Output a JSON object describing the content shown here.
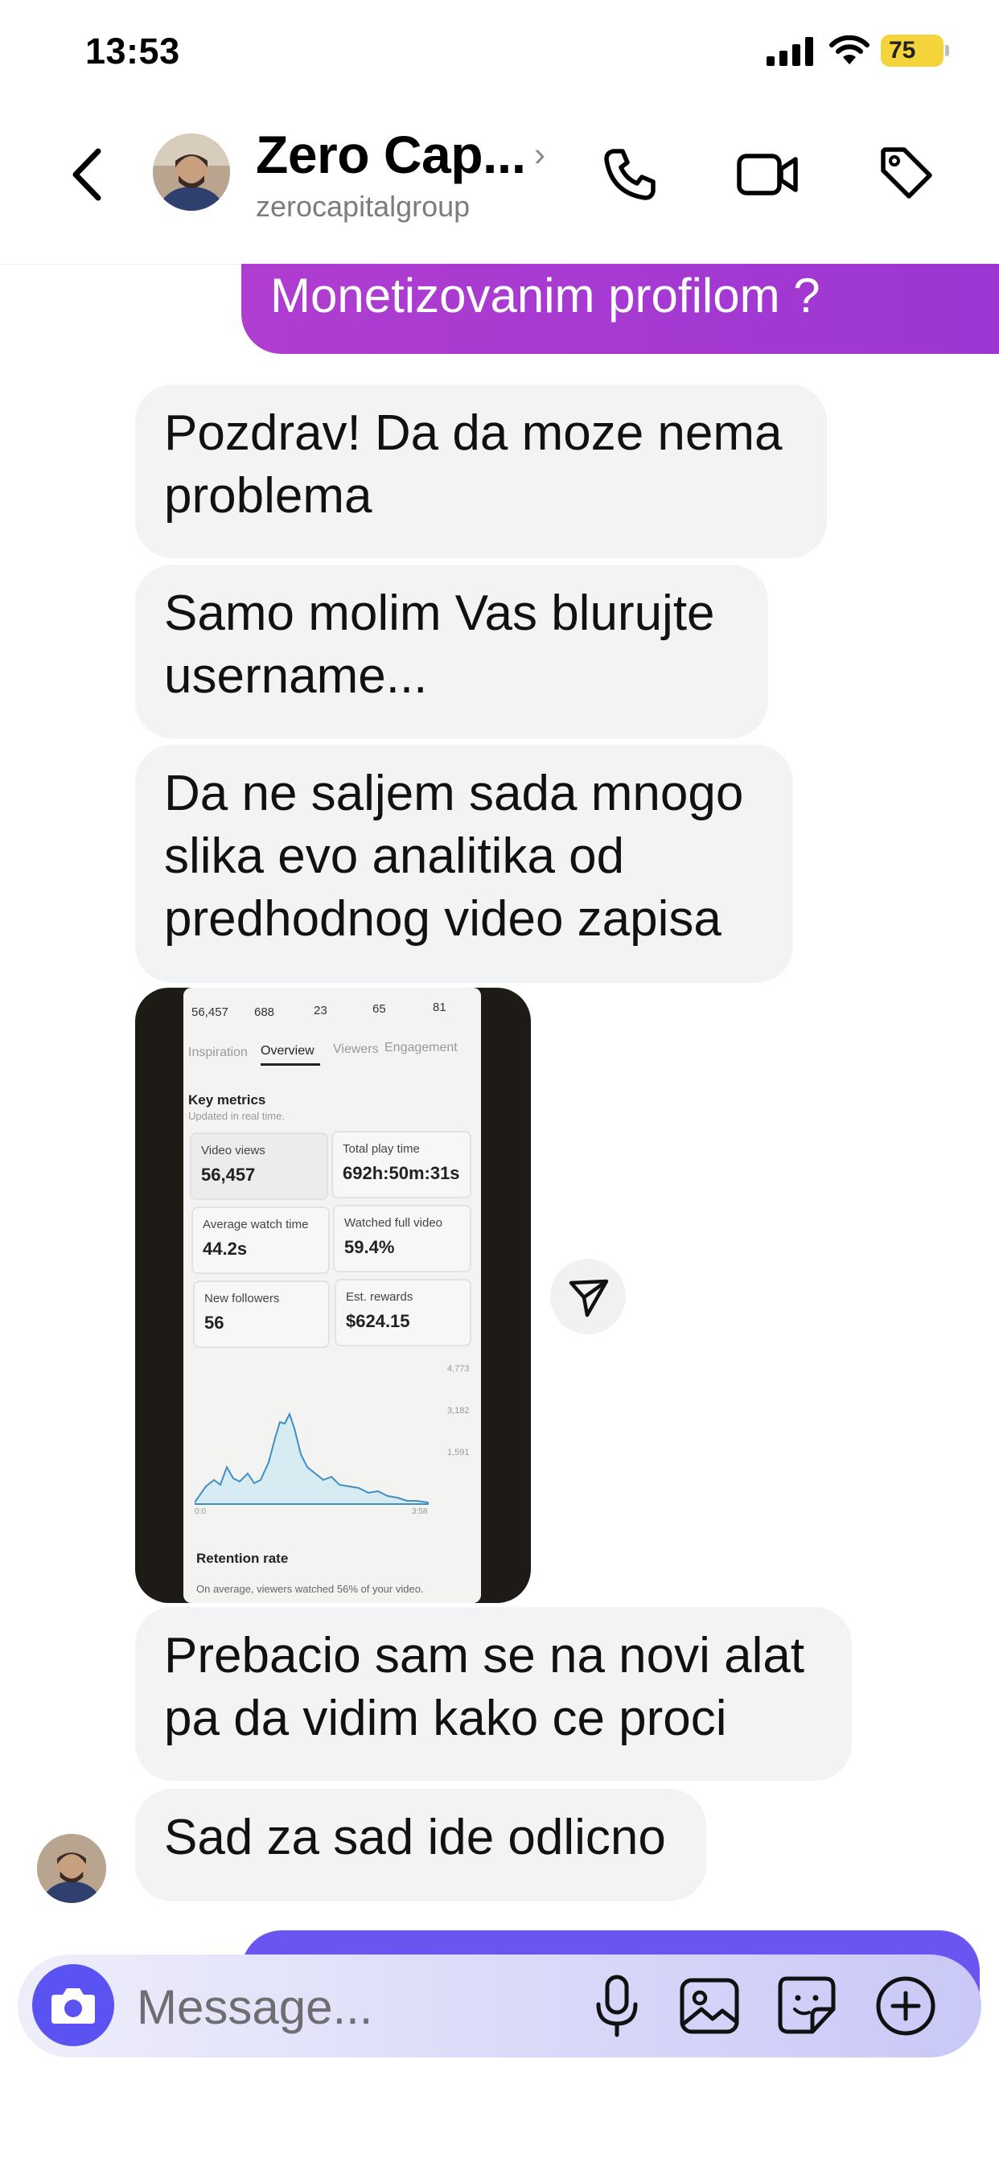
{
  "status_bar": {
    "time": "13:53",
    "battery": "75"
  },
  "header": {
    "name": "Zero Cap...",
    "username": "zerocapitalgroup",
    "icons": [
      "back-chevron-icon",
      "avatar",
      "call-icon",
      "video-call-icon",
      "tag-icon"
    ]
  },
  "messages": {
    "sent_top": "Monetizovanim profilom ?",
    "m1": "Pozdrav! Da da moze nema problema",
    "m2": "Samo molim Vas blurujte username...",
    "m3": "Da ne saljem sada mnogo slika evo analitika od predhodnog video zapisa",
    "m5": "Prebacio sam se na novi alat pa da vidim kako ce proci",
    "m6": "Sad za sad ide odlicno"
  },
  "photo": {
    "top_stats": [
      "56,457",
      "688",
      "23",
      "65",
      "81"
    ],
    "tabs": [
      "Inspiration",
      "Overview",
      "Viewers",
      "Engagement"
    ],
    "active_tab": "Overview",
    "key_metrics_title": "Key metrics",
    "key_metrics_subtitle": "Updated in real time.",
    "metrics": [
      {
        "label": "Video views",
        "value": "56,457"
      },
      {
        "label": "Total play time",
        "value": "692h:50m:31s"
      },
      {
        "label": "Average watch time",
        "value": "44.2s"
      },
      {
        "label": "Watched full video",
        "value": "59.4%"
      },
      {
        "label": "New followers",
        "value": "56"
      },
      {
        "label": "Est. rewards",
        "value": "$624.15"
      }
    ],
    "chart_ticks": [
      "4,773",
      "3,182",
      "1,591"
    ],
    "chart_x": [
      "0:0",
      "3:58"
    ],
    "retention_title": "Retention rate",
    "retention_text": "On average, viewers watched 56% of your video."
  },
  "composer": {
    "placeholder": "Message..."
  },
  "colors": {
    "sent_bubble": "#a63ad3",
    "received_bubble": "#f2f3f5",
    "camera_button": "#5a53f2",
    "accent": "#6b55f1"
  }
}
